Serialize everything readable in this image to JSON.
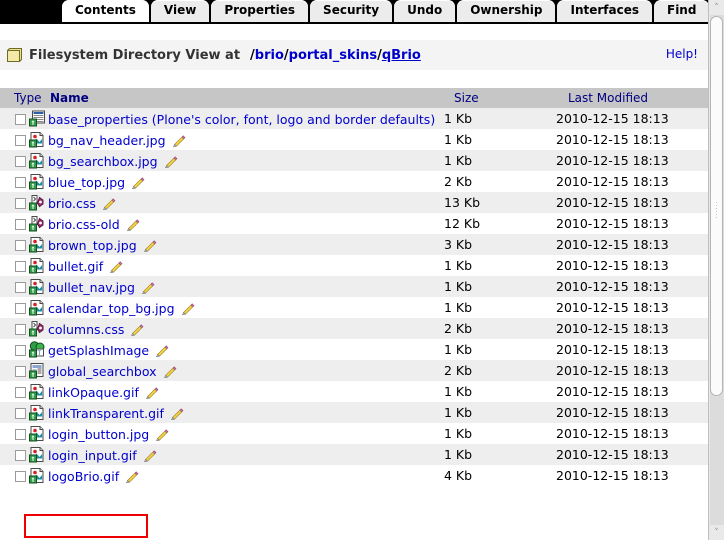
{
  "tabs": [
    {
      "label": "Contents",
      "active": true
    },
    {
      "label": "View",
      "active": false
    },
    {
      "label": "Properties",
      "active": false
    },
    {
      "label": "Security",
      "active": false
    },
    {
      "label": "Undo",
      "active": false
    },
    {
      "label": "Ownership",
      "active": false
    },
    {
      "label": "Interfaces",
      "active": false
    },
    {
      "label": "Find",
      "active": false
    }
  ],
  "header": {
    "title": "Filesystem Directory View at",
    "help_label": "Help!",
    "breadcrumb": [
      {
        "label": "brio",
        "last": false
      },
      {
        "label": "portal_skins",
        "last": false
      },
      {
        "label": "qBrio",
        "last": true
      }
    ]
  },
  "table": {
    "columns": {
      "type": "Type",
      "name": "Name",
      "size": "Size",
      "modified": "Last Modified"
    },
    "rows": [
      {
        "name": "base_properties (Plone's color, font, logo and border defaults)",
        "icon": "properties-icon",
        "size": "1 Kb",
        "modified": "2010-12-15 18:13",
        "editable": false,
        "highlighted": false
      },
      {
        "name": "bg_nav_header.jpg",
        "icon": "image-icon",
        "size": "1 Kb",
        "modified": "2010-12-15 18:13",
        "editable": true,
        "highlighted": false
      },
      {
        "name": "bg_searchbox.jpg",
        "icon": "image-icon",
        "size": "1 Kb",
        "modified": "2010-12-15 18:13",
        "editable": true,
        "highlighted": false
      },
      {
        "name": "blue_top.jpg",
        "icon": "image-icon",
        "size": "2 Kb",
        "modified": "2010-12-15 18:13",
        "editable": true,
        "highlighted": false
      },
      {
        "name": "brio.css",
        "icon": "stylesheet-icon",
        "size": "13 Kb",
        "modified": "2010-12-15 18:13",
        "editable": true,
        "highlighted": false
      },
      {
        "name": "brio.css-old",
        "icon": "stylesheet-icon",
        "size": "12 Kb",
        "modified": "2010-12-15 18:13",
        "editable": true,
        "highlighted": false
      },
      {
        "name": "brown_top.jpg",
        "icon": "image-icon",
        "size": "3 Kb",
        "modified": "2010-12-15 18:13",
        "editable": true,
        "highlighted": false
      },
      {
        "name": "bullet.gif",
        "icon": "image-icon",
        "size": "1 Kb",
        "modified": "2010-12-15 18:13",
        "editable": true,
        "highlighted": false
      },
      {
        "name": "bullet_nav.jpg",
        "icon": "image-icon",
        "size": "1 Kb",
        "modified": "2010-12-15 18:13",
        "editable": true,
        "highlighted": false
      },
      {
        "name": "calendar_top_bg.jpg",
        "icon": "image-icon",
        "size": "1 Kb",
        "modified": "2010-12-15 18:13",
        "editable": true,
        "highlighted": false
      },
      {
        "name": "columns.css",
        "icon": "stylesheet-icon",
        "size": "2 Kb",
        "modified": "2010-12-15 18:13",
        "editable": true,
        "highlighted": false
      },
      {
        "name": "getSplashImage",
        "icon": "script-icon",
        "size": "1 Kb",
        "modified": "2010-12-15 18:13",
        "editable": true,
        "highlighted": false
      },
      {
        "name": "global_searchbox",
        "icon": "page-template-icon",
        "size": "2 Kb",
        "modified": "2010-12-15 18:13",
        "editable": true,
        "highlighted": false
      },
      {
        "name": "linkOpaque.gif",
        "icon": "image-icon",
        "size": "1 Kb",
        "modified": "2010-12-15 18:13",
        "editable": true,
        "highlighted": false
      },
      {
        "name": "linkTransparent.gif",
        "icon": "image-icon",
        "size": "1 Kb",
        "modified": "2010-12-15 18:13",
        "editable": true,
        "highlighted": false
      },
      {
        "name": "login_button.jpg",
        "icon": "image-icon",
        "size": "1 Kb",
        "modified": "2010-12-15 18:13",
        "editable": true,
        "highlighted": false
      },
      {
        "name": "login_input.gif",
        "icon": "image-icon",
        "size": "1 Kb",
        "modified": "2010-12-15 18:13",
        "editable": true,
        "highlighted": false
      },
      {
        "name": "logoBrio.gif",
        "icon": "image-icon",
        "size": "4 Kb",
        "modified": "2010-12-15 18:13",
        "editable": true,
        "highlighted": true
      }
    ]
  },
  "scrollbar": {
    "up_arrow": "˄",
    "down_arrow": "˅"
  },
  "colors": {
    "link": "#0000cc",
    "column_header_text": "#000080",
    "column_header_bg": "#c6c6c6",
    "row_alt_bg": "#eeeeee",
    "highlight_border": "#ee0000",
    "tabbar_bg": "#000000"
  }
}
